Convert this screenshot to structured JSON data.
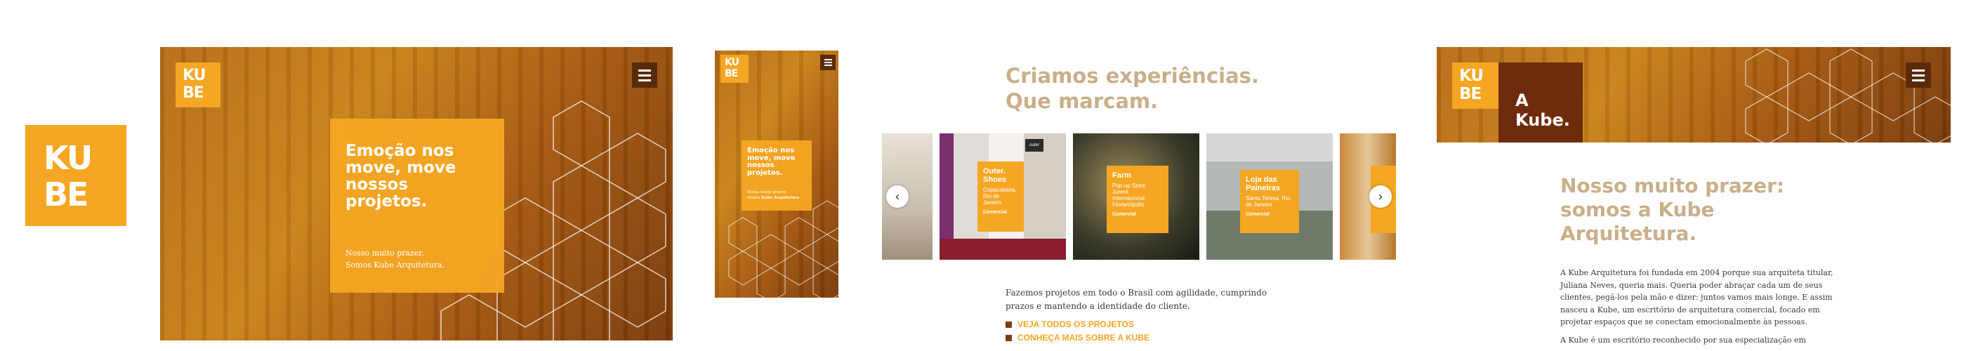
{
  "brand": {
    "logo_line1": "KU",
    "logo_line2": "BE"
  },
  "desktop_hero": {
    "title": "Emoção nos move, move nossos projetos.",
    "subtitle_line1": "Nosso muito prazer.",
    "subtitle_line2": "Somos Kube Arquitetura."
  },
  "mobile_hero": {
    "title": "Emoção nos move, move nossos projetos.",
    "subtitle_line1": "Nosso muito prazer.",
    "subtitle_line2_plain": "Somos ",
    "subtitle_line2_bold": "Kube Arquitetura"
  },
  "projects": {
    "heading_line1": "Criamos experiências.",
    "heading_line2": "Que marcam.",
    "cards": [
      {
        "title": "Outer. Shoes",
        "location": "Copacabana, Rio de Janeiro",
        "kind": "Comercial"
      },
      {
        "title": "Farm",
        "location": "Pop-up Store Jurerê Internacional, Florianópolis",
        "kind": "Comercial"
      },
      {
        "title": "Loja das Paineiras",
        "location": "Santa Teresa, Rio de Janeiro",
        "kind": "Comercial"
      }
    ],
    "store_sign": "outer",
    "prev_arrow": "‹",
    "next_arrow": "›",
    "description": "Fazemos projetos em todo o Brasil com agilidade, cumprindo prazos e mantendo a identidade do cliente.",
    "link1": "VEJA TODOS OS PROJETOS",
    "link2": "CONHEÇA MAIS SOBRE A KUBE"
  },
  "about": {
    "banner_title": "A Kube.",
    "heading_line1": "Nosso muito prazer:",
    "heading_line2": "somos a Kube",
    "heading_line3": "Arquitetura.",
    "para1": "A Kube Arquitetura foi fundada em 2004 porque sua arquiteta titular, Juliana Neves, queria mais. Queria poder abraçar cada um de seus clientes, pegá-los pela mão e dizer: juntos vamos mais longe. E assim nasceu a Kube, um escritório de arquitetura comercial, focado em projetar espaços que se conectam emocionalmente às pessoas.",
    "para2": "A Kube é um escritório reconhecido por sua especialização em"
  },
  "colors": {
    "accent": "#f5a623",
    "dark": "#5a2a0c",
    "tan": "#c9b08a"
  },
  "icons": {
    "menu": "hamburger-menu-icon",
    "prev": "chevron-left-icon",
    "next": "chevron-right-icon"
  }
}
